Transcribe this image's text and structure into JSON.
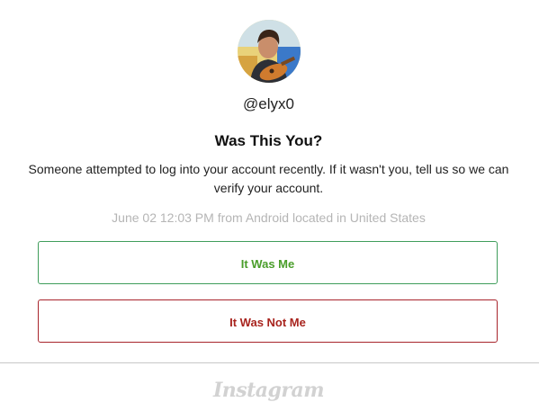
{
  "account": {
    "avatar_icon": "user-profile-photo",
    "username": "@elyx0"
  },
  "prompt": {
    "title": "Was This You?",
    "message": "Someone attempted to log into your account recently. If it wasn't you, tell us so we can verify your account.",
    "login_details": "June 02 12:03 PM from Android located in United States"
  },
  "actions": {
    "confirm_label": "It Was Me",
    "deny_label": "It Was Not Me",
    "confirm_color": "#4a9e2a",
    "deny_color": "#a8241e"
  },
  "footer": {
    "brand": "Instagram"
  }
}
